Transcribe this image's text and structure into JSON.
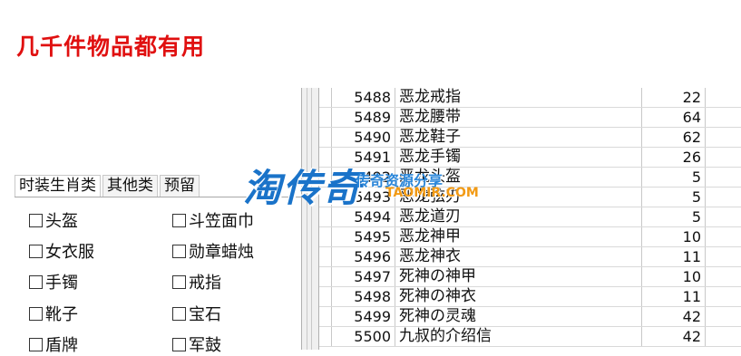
{
  "banner": {
    "text": "几千件物品都有用"
  },
  "tabs": [
    "时装生肖类",
    "其他类",
    "预留"
  ],
  "checkboxes": [
    {
      "label": "头盔",
      "checked": false
    },
    {
      "label": "斗笠面巾",
      "checked": false
    },
    {
      "label": "女衣服",
      "checked": false
    },
    {
      "label": "勋章蜡烛",
      "checked": false
    },
    {
      "label": "手镯",
      "checked": false
    },
    {
      "label": "戒指",
      "checked": false
    },
    {
      "label": "靴子",
      "checked": false
    },
    {
      "label": "宝石",
      "checked": false
    },
    {
      "label": "盾牌",
      "checked": false
    },
    {
      "label": "军鼓",
      "checked": false
    }
  ],
  "table": {
    "rows": [
      {
        "id": "5488",
        "name": "恶龙戒指",
        "value": "22"
      },
      {
        "id": "5489",
        "name": "恶龙腰带",
        "value": "64"
      },
      {
        "id": "5490",
        "name": "恶龙鞋子",
        "value": "62"
      },
      {
        "id": "5491",
        "name": "恶龙手镯",
        "value": "26"
      },
      {
        "id": "5492",
        "name": "恶龙头盔",
        "value": "5"
      },
      {
        "id": "5493",
        "name": "恶龙弦刃",
        "value": "5"
      },
      {
        "id": "5494",
        "name": "恶龙道刃",
        "value": "5"
      },
      {
        "id": "5495",
        "name": "恶龙神甲",
        "value": "10"
      },
      {
        "id": "5496",
        "name": "恶龙神衣",
        "value": "11"
      },
      {
        "id": "5497",
        "name": "死神の神甲",
        "value": "10"
      },
      {
        "id": "5498",
        "name": "死神の神衣",
        "value": "11"
      },
      {
        "id": "5499",
        "name": "死神の灵魂",
        "value": "42"
      },
      {
        "id": "5500",
        "name": "九叔的介绍信",
        "value": "42"
      }
    ]
  },
  "watermark": {
    "main": "淘传奇",
    "sub": "传奇资源分享",
    "url": "TAOMIR.COM"
  }
}
